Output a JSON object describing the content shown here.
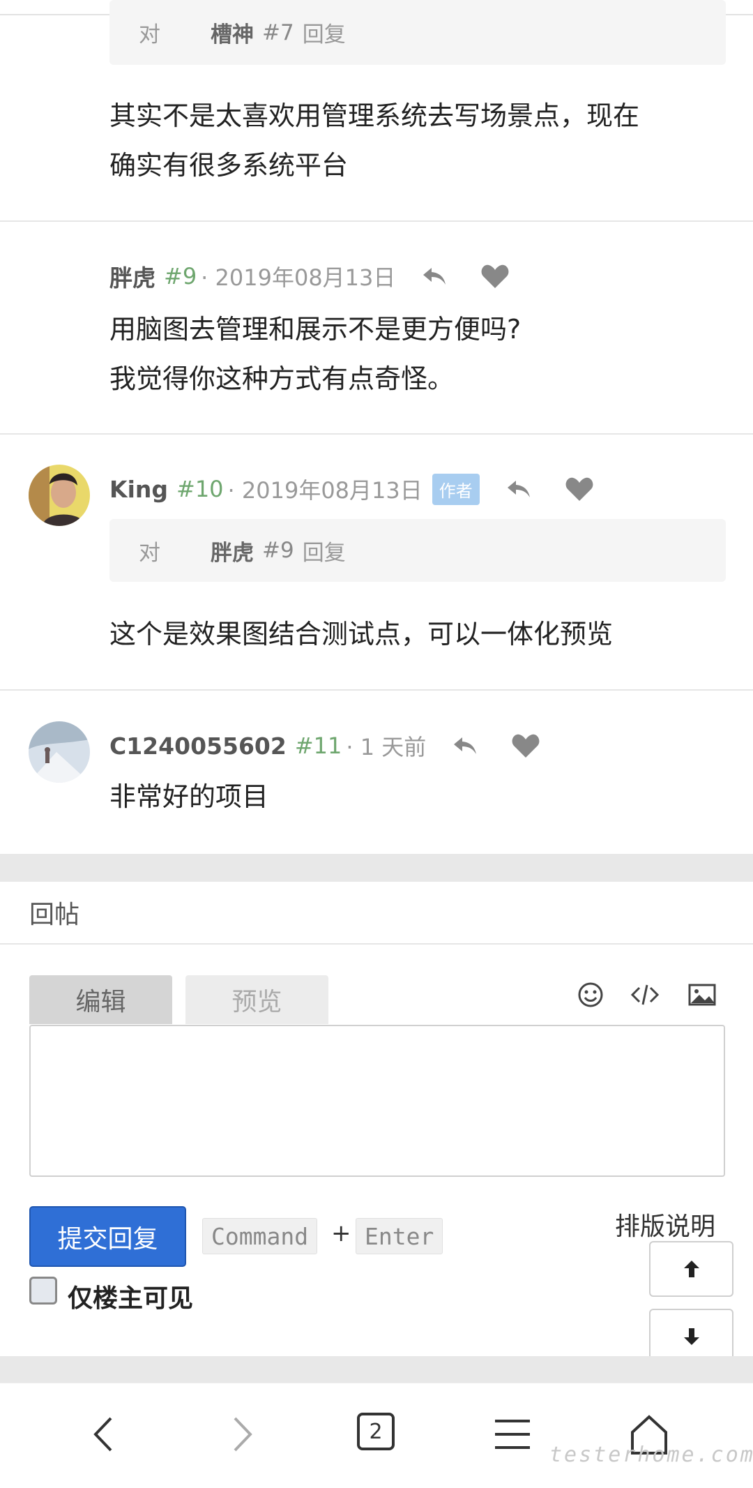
{
  "comment7_tail": {
    "quote": {
      "prefix": "对",
      "name": "槽神",
      "floor": "#7",
      "action": "回复"
    },
    "lines": [
      "其实不是太喜欢用管理系统去写场景点，现在",
      "确实有很多系统平台"
    ]
  },
  "comment9": {
    "author": "胖虎",
    "floor": "#9",
    "time": "· 2019年08月13日",
    "lines": [
      "用脑图去管理和展示不是更方便吗?",
      "我觉得你这种方式有点奇怪。"
    ]
  },
  "comment10": {
    "author": "King",
    "floor": "#10",
    "time": "· 2019年08月13日",
    "badge": "作者",
    "quote": {
      "prefix": "对",
      "name": "胖虎",
      "floor": "#9",
      "action": "回复"
    },
    "lines": [
      "这个是效果图结合测试点，可以一体化预览"
    ]
  },
  "comment11": {
    "author": "C1240055602",
    "floor": "#11",
    "time": "· 1 天前",
    "lines": [
      "非常好的项目"
    ]
  },
  "reply_form": {
    "header": "回帖",
    "tab_edit": "编辑",
    "tab_preview": "预览",
    "textarea_value": "",
    "submit": "提交回复",
    "kbd1": "Command",
    "plus": "+",
    "kbd2": "Enter",
    "format_help": "排版说明",
    "only_owner": "仅楼主可见"
  },
  "bottom_nav": {
    "tab_count": "2"
  },
  "watermark": "testerhome.com",
  "colors": {
    "accent": "#2f6fd6",
    "floor": "#6ea66e",
    "badge": "#a8cdf0"
  }
}
